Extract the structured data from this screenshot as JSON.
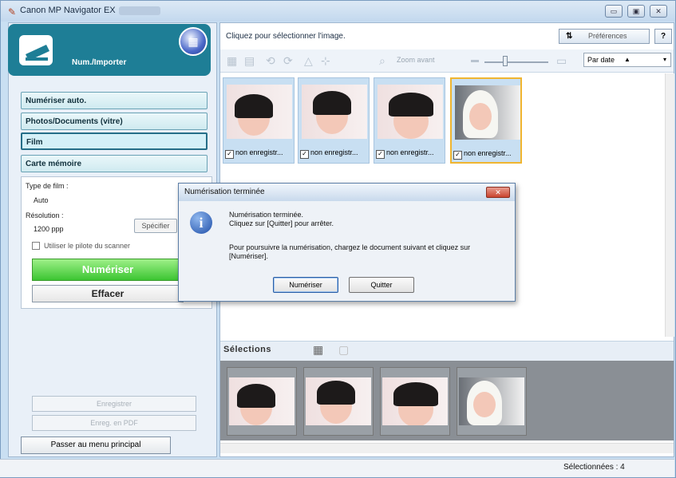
{
  "window": {
    "title": "Canon MP Navigator EX"
  },
  "left_panel": {
    "mode_title": "Num./Importer",
    "sources": [
      "Numériser auto.",
      "Photos/Documents (vitre)",
      "Film",
      "Carte mémoire"
    ],
    "active_source": "Film",
    "film_type_label": "Type de film :",
    "film_type_value": "Auto",
    "resolution_label": "Résolution :",
    "resolution_value": "1200 ppp",
    "specify_button": "Spécifier",
    "scanner_driver_label": "Utiliser le pilote du scanner",
    "scan_button": "Numériser",
    "clear_button": "Effacer",
    "save_button": "Enregistrer",
    "save_pdf_button": "Enreg. en PDF",
    "main_menu_button": "Passer au menu principal"
  },
  "main": {
    "instruction": "Cliquez pour sélectionner l'image.",
    "preferences_button": "Préférences",
    "help_button": "?",
    "zoom_label": "Zoom avant",
    "sort_label": "Par date",
    "thumbnails": [
      {
        "caption": "non enregistr...",
        "checked": true,
        "selected": false
      },
      {
        "caption": "non enregistr...",
        "checked": true,
        "selected": false
      },
      {
        "caption": "non enregistr...",
        "checked": true,
        "selected": false
      },
      {
        "caption": "non enregistr...",
        "checked": true,
        "selected": true
      }
    ],
    "selections_title": "Sélections",
    "selection_count_text": "Sélectionnées : 4"
  },
  "dialog": {
    "title": "Numérisation terminée",
    "line1": "Numérisation terminée.",
    "line2": "Cliquez sur [Quitter] pour arrêter.",
    "line3": "Pour poursuivre la numérisation, chargez le document suivant et cliquez sur [Numériser].",
    "scan_button": "Numériser",
    "quit_button": "Quitter"
  },
  "colors": {
    "accent": "#1e7e96",
    "scan_green": "#3cc532",
    "selection_border": "#f0b530"
  }
}
